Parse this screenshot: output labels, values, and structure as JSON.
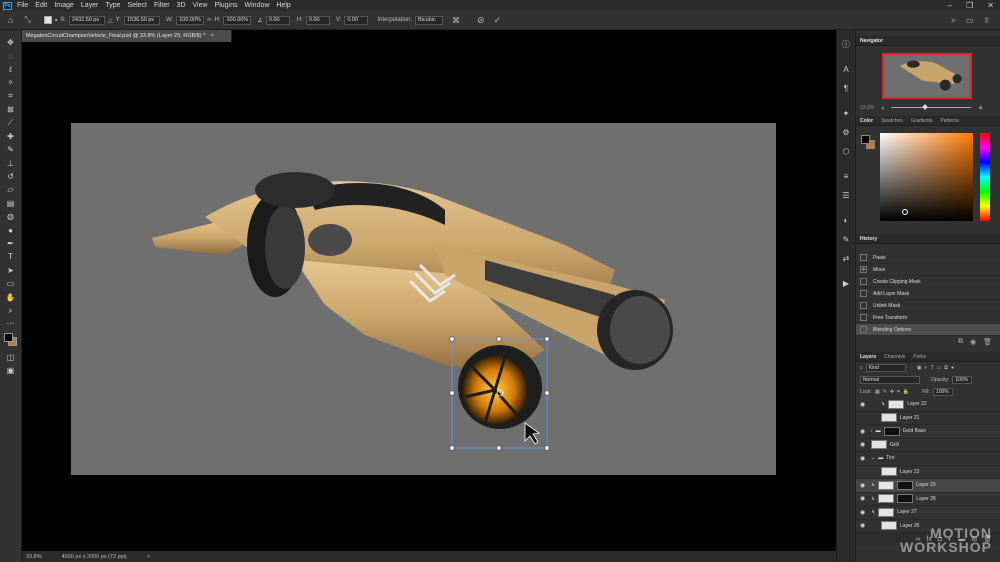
{
  "app": {
    "logo": "Ps"
  },
  "menu": [
    "File",
    "Edit",
    "Image",
    "Layer",
    "Type",
    "Select",
    "Filter",
    "3D",
    "View",
    "Plugins",
    "Window",
    "Help"
  ],
  "window_controls": [
    "–",
    "❐",
    "✕"
  ],
  "options": {
    "x_label": "X:",
    "x_value": "2432.50 px",
    "y_label": "Y:",
    "y_value": "1536.50 px",
    "w_label": "W:",
    "w_value": "100.00%",
    "h_label": "H:",
    "h_value": "100.00%",
    "angle_value": "0.00",
    "hskew_label": "H:",
    "hskew_value": "0.00",
    "vskew_label": "V:",
    "vskew_value": "0.00",
    "interp_label": "Interpolation:",
    "interp_value": "Bicubic"
  },
  "document": {
    "tab_title": "MegatonCircuitChampionVehicle_Final.psd @ 33.8% (Layer 29, RGB/8) *",
    "close": "×"
  },
  "status": {
    "zoom": "33.8%",
    "size": "4000 px x 2000 px (72 ppi)",
    "arrow": ">"
  },
  "panels": {
    "navigator": {
      "tab": "Navigator",
      "zoom": "33.8%"
    },
    "color_tabs": [
      "Color",
      "Swatches",
      "Gradients",
      "Patterns"
    ],
    "history": {
      "tab": "History",
      "items": [
        "Paste",
        "Move",
        "Create Clipping Mask",
        "Add Layer Mask",
        "Unlink Mask",
        "Free Transform",
        "Blending Options"
      ],
      "selected_index": 6
    },
    "layers": {
      "tabs": [
        "Layers",
        "Channels",
        "Paths"
      ],
      "filter": "Kind",
      "blend_mode": "Normal",
      "opacity_label": "Opacity:",
      "opacity": "100%",
      "lock_label": "Lock:",
      "fill_label": "Fill:",
      "fill": "100%",
      "rows": [
        {
          "name": "Layer 22"
        },
        {
          "name": "Layer 21"
        },
        {
          "name": "Gold Base"
        },
        {
          "name": "Grill"
        },
        {
          "name": "Tire"
        },
        {
          "name": "Layer 23"
        },
        {
          "name": "Layer 29"
        },
        {
          "name": "Layer 28"
        },
        {
          "name": "Layer 27"
        },
        {
          "name": "Layer 26"
        }
      ]
    }
  },
  "watermark": {
    "line1": "MOTION",
    "line2": "WORKSHOP"
  },
  "colors": {
    "foreground": "#000000",
    "background": "#c67a20",
    "accent": "#e3262b"
  }
}
